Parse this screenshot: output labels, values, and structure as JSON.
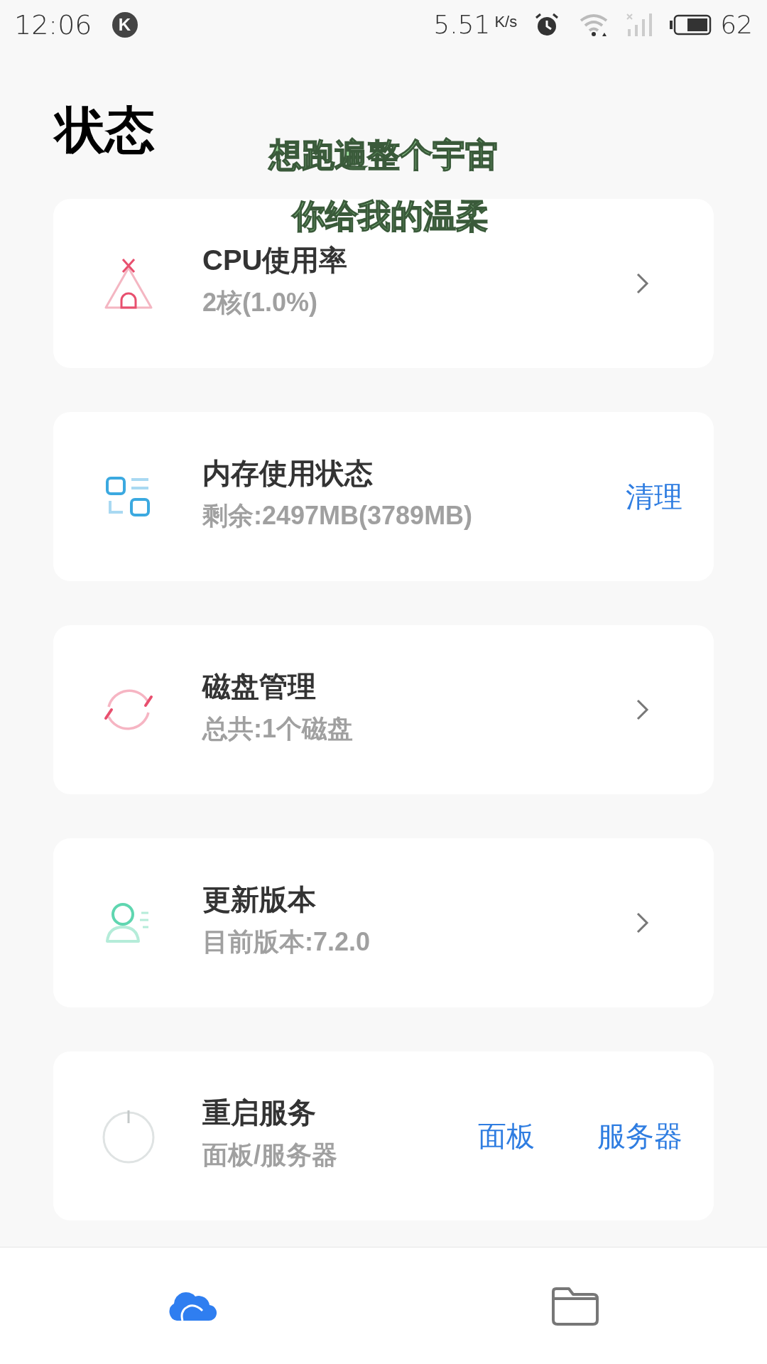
{
  "status_bar": {
    "time": "12:06",
    "badge": "K",
    "speed": "5.51",
    "speed_unit": "K/s",
    "battery": "62"
  },
  "title": "状态",
  "lyrics": [
    "想跑遍整个宇宙",
    "你给我的温柔"
  ],
  "cards": [
    {
      "kind": "chevron",
      "title": "CPU使用率",
      "subtitle": "2核(1.0%)"
    },
    {
      "kind": "actions",
      "title": "内存使用状态",
      "subtitle": "剩余:2497MB(3789MB)",
      "actions": [
        "清理"
      ]
    },
    {
      "kind": "chevron",
      "title": "磁盘管理",
      "subtitle": "总共:1个磁盘"
    },
    {
      "kind": "chevron",
      "title": "更新版本",
      "subtitle": "目前版本:7.2.0"
    },
    {
      "kind": "actions",
      "title": "重启服务",
      "subtitle": "面板/服务器",
      "actions": [
        "面板",
        "服务器"
      ]
    }
  ],
  "nav": [
    {
      "selected": true
    },
    {
      "selected": false
    }
  ]
}
